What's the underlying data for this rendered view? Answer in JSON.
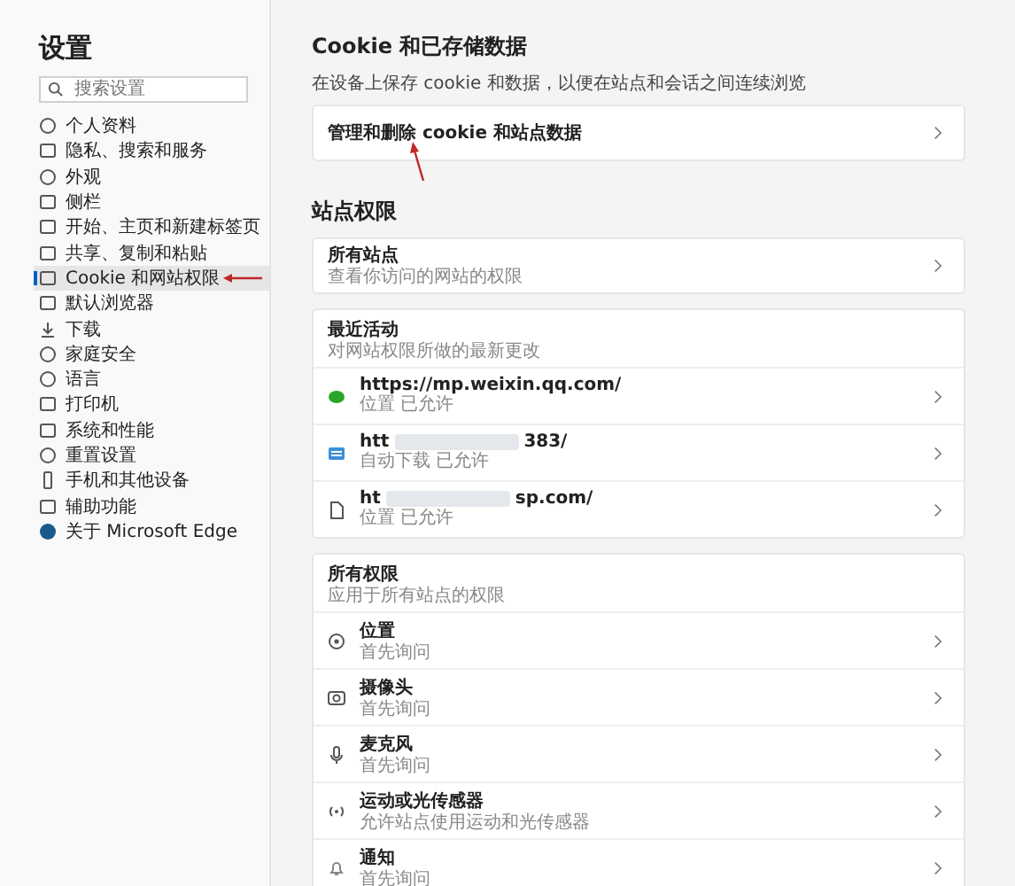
{
  "sidebar": {
    "title": "设置",
    "search": {
      "placeholder": "搜索设置"
    },
    "items": [
      {
        "kind": "profile",
        "label": "个人资料",
        "selected": false
      },
      {
        "kind": "lock",
        "label": "隐私、搜索和服务",
        "selected": false
      },
      {
        "kind": "palette",
        "label": "外观",
        "selected": false
      },
      {
        "kind": "panel",
        "label": "侧栏",
        "selected": false
      },
      {
        "kind": "home",
        "label": "开始、主页和新建标签页",
        "selected": false
      },
      {
        "kind": "share",
        "label": "共享、复制和粘贴",
        "selected": false
      },
      {
        "kind": "cookie",
        "label": "Cookie 和网站权限",
        "selected": true,
        "annotated": true
      },
      {
        "kind": "browser",
        "label": "默认浏览器",
        "selected": false
      },
      {
        "kind": "download",
        "label": "下载",
        "selected": false
      },
      {
        "kind": "family",
        "label": "家庭安全",
        "selected": false
      },
      {
        "kind": "language",
        "label": "语言",
        "selected": false
      },
      {
        "kind": "printer",
        "label": "打印机",
        "selected": false
      },
      {
        "kind": "system",
        "label": "系统和性能",
        "selected": false
      },
      {
        "kind": "reset",
        "label": "重置设置",
        "selected": false
      },
      {
        "kind": "phone",
        "label": "手机和其他设备",
        "selected": false
      },
      {
        "kind": "accessibility",
        "label": "辅助功能",
        "selected": false
      },
      {
        "kind": "edge",
        "label": "关于 Microsoft Edge",
        "selected": false
      }
    ]
  },
  "cookies": {
    "title": "Cookie 和已存储数据",
    "description": "在设备上保存 cookie 和数据，以便在站点和会话之间连续浏览",
    "link": {
      "label": "管理和删除 cookie 和站点数据",
      "annotated": true
    }
  },
  "site_permissions": {
    "title": "站点权限",
    "all_sites": {
      "label": "所有站点",
      "description": "查看你访问的网站的权限"
    },
    "recent": {
      "title": "最近活动",
      "description": "对网站权限所做的最新更改",
      "items": [
        {
          "kind": "dot",
          "url_prefix": "https://mp.weixin.qq.com/",
          "redacted": false,
          "detail": "位置 已允许"
        },
        {
          "kind": "card",
          "url_prefix": "htt",
          "url_suffix": "383/",
          "redacted": true,
          "detail": "自动下载 已允许"
        },
        {
          "kind": "page",
          "url_prefix": "ht",
          "url_suffix": "sp.com/",
          "redacted": true,
          "detail": "位置 已允许"
        }
      ]
    },
    "permissions": {
      "title": "所有权限",
      "description": "应用于所有站点的权限",
      "items": [
        {
          "kind": "location",
          "label": "位置",
          "detail": "首先询问"
        },
        {
          "kind": "camera",
          "label": "摄像头",
          "detail": "首先询问"
        },
        {
          "kind": "mic",
          "label": "麦克风",
          "detail": "首先询问"
        },
        {
          "kind": "sensor",
          "label": "运动或光传感器",
          "detail": "允许站点使用运动和光传感器"
        },
        {
          "kind": "bell",
          "label": "通知",
          "detail": "首先询问"
        }
      ]
    }
  }
}
